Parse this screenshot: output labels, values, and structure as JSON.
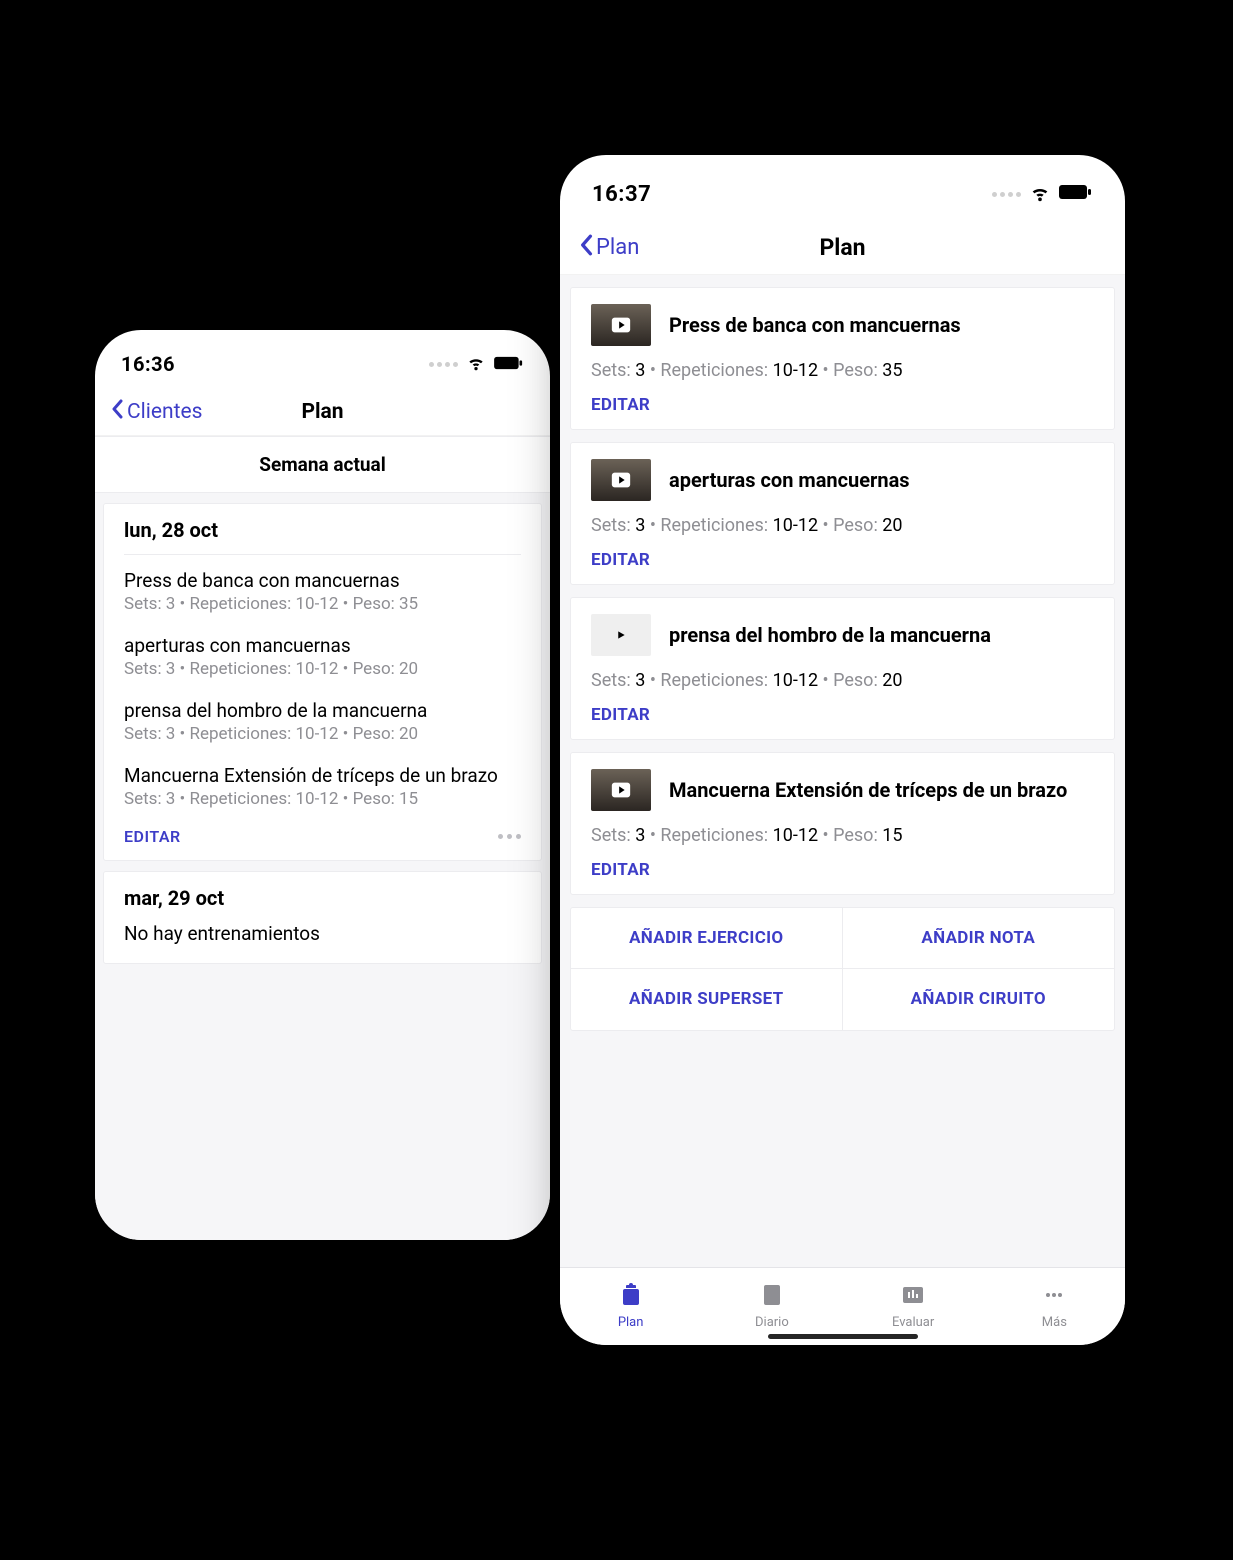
{
  "left": {
    "status": {
      "time": "16:36"
    },
    "nav": {
      "back_label": "Clientes",
      "title": "Plan"
    },
    "section_header": "Semana actual",
    "days": [
      {
        "title": "lun, 28 oct",
        "exercises": [
          {
            "name": "Press de banca con mancuernas",
            "detail": "Sets: 3 • Repeticiones: 10-12 • Peso: 35"
          },
          {
            "name": "aperturas con mancuernas",
            "detail": "Sets: 3 • Repeticiones: 10-12 • Peso: 20"
          },
          {
            "name": "prensa del hombro de la mancuerna",
            "detail": "Sets: 3 • Repeticiones: 10-12 • Peso: 20"
          },
          {
            "name": "Mancuerna Extensión de tríceps de un brazo",
            "detail": "Sets: 3 • Repeticiones: 10-12 • Peso: 15"
          }
        ],
        "edit_label": "EDITAR"
      },
      {
        "title": "mar, 29 oct",
        "no_training": "No hay entrenamientos"
      }
    ]
  },
  "right": {
    "status": {
      "time": "16:37"
    },
    "nav": {
      "back_label": "Plan",
      "title": "Plan"
    },
    "labels": {
      "sets": "Sets",
      "reps": "Repeticiones",
      "weight": "Peso",
      "edit": "EDITAR"
    },
    "exercises": [
      {
        "name": "Press de banca con mancuernas",
        "sets": "3",
        "reps": "10-12",
        "weight": "35"
      },
      {
        "name": "aperturas con mancuernas",
        "sets": "3",
        "reps": "10-12",
        "weight": "20"
      },
      {
        "name": "prensa del hombro de la mancuerna",
        "sets": "3",
        "reps": "10-12",
        "weight": "20"
      },
      {
        "name": "Mancuerna Extensión de tríceps de un brazo",
        "sets": "3",
        "reps": "10-12",
        "weight": "15"
      }
    ],
    "actions": {
      "add_exercise": "AÑADIR EJERCICIO",
      "add_note": "AÑADIR NOTA",
      "add_superset": "AÑADIR SUPERSET",
      "add_circuit": "AÑADIR CIRUITO"
    },
    "tabs": {
      "plan": "Plan",
      "diario": "Diario",
      "evaluar": "Evaluar",
      "more": "Más"
    }
  }
}
